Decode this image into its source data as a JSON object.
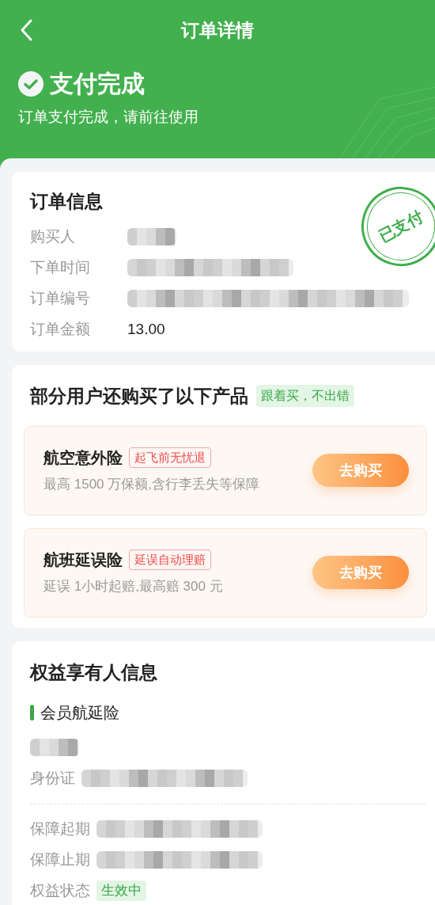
{
  "nav": {
    "title": "订单详情"
  },
  "status": {
    "title": "支付完成",
    "subtitle": "订单支付完成，请前往使用"
  },
  "order_info": {
    "title": "订单信息",
    "stamp": "已支付",
    "rows": [
      {
        "label": "购买人",
        "kind": "blur_short"
      },
      {
        "label": "下单时间",
        "kind": "blur_medium"
      },
      {
        "label": "订单编号",
        "kind": "blur_long"
      },
      {
        "label": "订单金额",
        "kind": "text",
        "value": "13.00"
      }
    ]
  },
  "recommend": {
    "title": "部分用户还购买了以下产品",
    "badge": "跟着买，不出错",
    "products": [
      {
        "name": "航空意外险",
        "tag": "起飞前无忧退",
        "desc": "最高 1500 万保额,含行李丢失等保障",
        "button": "去购买"
      },
      {
        "name": "航班延误险",
        "tag": "延误自动理赔",
        "desc": "延误 1小时起赔,最高赔 300 元",
        "button": "去购买"
      }
    ]
  },
  "beneficiary": {
    "title": "权益享有人信息",
    "section": "会员航延险",
    "rows": [
      {
        "kind": "blur_name"
      },
      {
        "label": "身份证",
        "kind": "blur_medium"
      },
      {
        "kind": "divider"
      },
      {
        "label": "保障起期",
        "kind": "blur_medium"
      },
      {
        "label": "保障止期",
        "kind": "blur_medium"
      },
      {
        "label": "权益状态",
        "kind": "badge",
        "value": "生效中"
      }
    ]
  }
}
